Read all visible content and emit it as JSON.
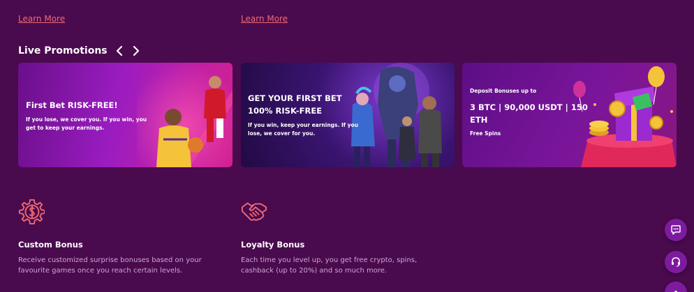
{
  "top_links": [
    {
      "label": "Learn More"
    },
    {
      "label": "Learn More"
    }
  ],
  "section": {
    "title": "Live Promotions"
  },
  "promotions": [
    {
      "title": "First Bet RISK-FREE!",
      "description": "If you lose, we cover you. If you win, you get to keep your earnings."
    },
    {
      "title": "GET YOUR FIRST BET 100% RISK-FREE",
      "description": "If you win, keep your earnings. If you lose, we cover for you."
    },
    {
      "subtitle": "Deposit Bonuses up to",
      "title": "3 BTC | 90,000 USDT | 150 ETH",
      "extra": "Free Spins"
    }
  ],
  "features": [
    {
      "icon": "dollar-gear-icon",
      "title": "Custom Bonus",
      "description": "Receive customized surprise bonuses based on your favourite games once you reach certain levels."
    },
    {
      "icon": "handshake-icon",
      "title": "Loyalty Bonus",
      "description": "Each time you level up, you get free crypto, spins, cashback (up to 20%) and so much more."
    }
  ],
  "floating_buttons": [
    {
      "icon": "chat-icon"
    },
    {
      "icon": "headset-icon"
    },
    {
      "icon": "arrow-up-icon"
    }
  ],
  "colors": {
    "background": "#4a0a4e",
    "link": "#f06a72",
    "icon_accent": "#f06a72",
    "float_button": "#7d1b9e"
  }
}
